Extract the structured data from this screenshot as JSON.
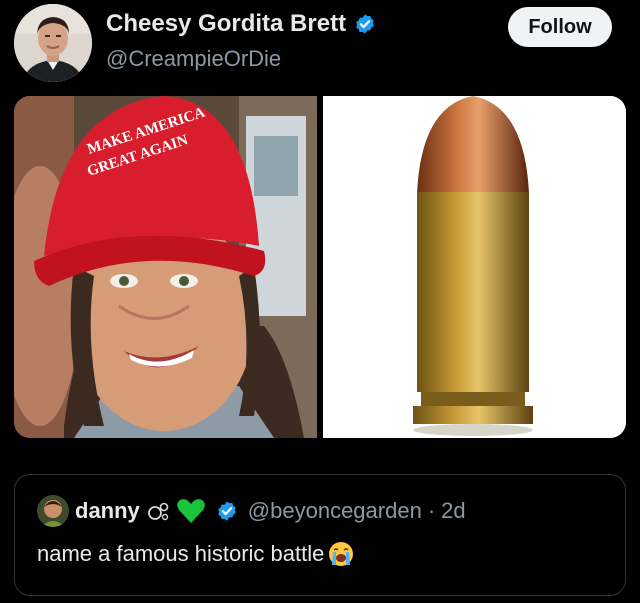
{
  "author": {
    "display_name": "Cheesy Gordita Brett",
    "handle": "@CreampieOrDie"
  },
  "actions": {
    "follow_label": "Follow"
  },
  "media": {
    "left_image": {
      "hat_text_line1": "MAKE AMERICA",
      "hat_text_line2": "GREAT AGAIN"
    }
  },
  "quote": {
    "display_name": "danny",
    "handle": "@beyoncegarden",
    "separator": "·",
    "timestamp": "2d",
    "text": "name a famous historic battle"
  },
  "icons": {
    "verified": "verified-badge-icon",
    "bubbles": "bubbles-emoji-icon",
    "green_heart": "green-heart-emoji-icon",
    "loudly_crying": "loudly-crying-face-emoji-icon"
  },
  "colors": {
    "background": "#000000",
    "text_primary": "#e7e9ea",
    "text_secondary": "#8b98a5",
    "verified_blue": "#1d9bf0",
    "follow_bg": "#eff3f4",
    "card_border": "#2f3336"
  }
}
